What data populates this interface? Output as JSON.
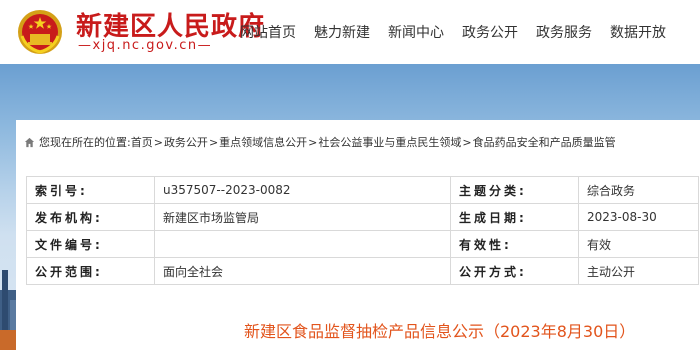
{
  "header": {
    "site_title": "新建区人民政府",
    "site_url": "xjq.nc.gov.cn",
    "nav": [
      "网站首页",
      "魅力新建",
      "新闻中心",
      "政务公开",
      "政务服务",
      "数据开放"
    ]
  },
  "breadcrumb": {
    "prefix": "您现在所在的位置: ",
    "items": [
      "首页",
      "政务公开",
      "重点领域信息公开",
      "社会公益事业与重点民生领域",
      "食品药品安全和产品质量监管"
    ],
    "separator": ">"
  },
  "metadata": {
    "index_label": "索引号:",
    "index_value": "u357507--2023-0082",
    "category_label": "主题分类:",
    "category_value": "综合政务",
    "publisher_label": "发布机构:",
    "publisher_value": "新建区市场监管局",
    "date_label": "生成日期:",
    "date_value": "2023-08-30",
    "docno_label": "文件编号:",
    "docno_value": "",
    "validity_label": "有效性:",
    "validity_value": "有效",
    "scope_label": "公开范围:",
    "scope_value": "面向全社会",
    "method_label": "公开方式:",
    "method_value": "主动公开"
  },
  "document": {
    "title": "新建区食品监督抽检产品信息公示（2023年8月30日）"
  },
  "colors": {
    "brand_red": "#c81b1b",
    "title_orange": "#e2541c",
    "banner_blue": "#8db8de"
  },
  "icons": {
    "emblem": "national-emblem-icon",
    "home": "home-icon"
  }
}
